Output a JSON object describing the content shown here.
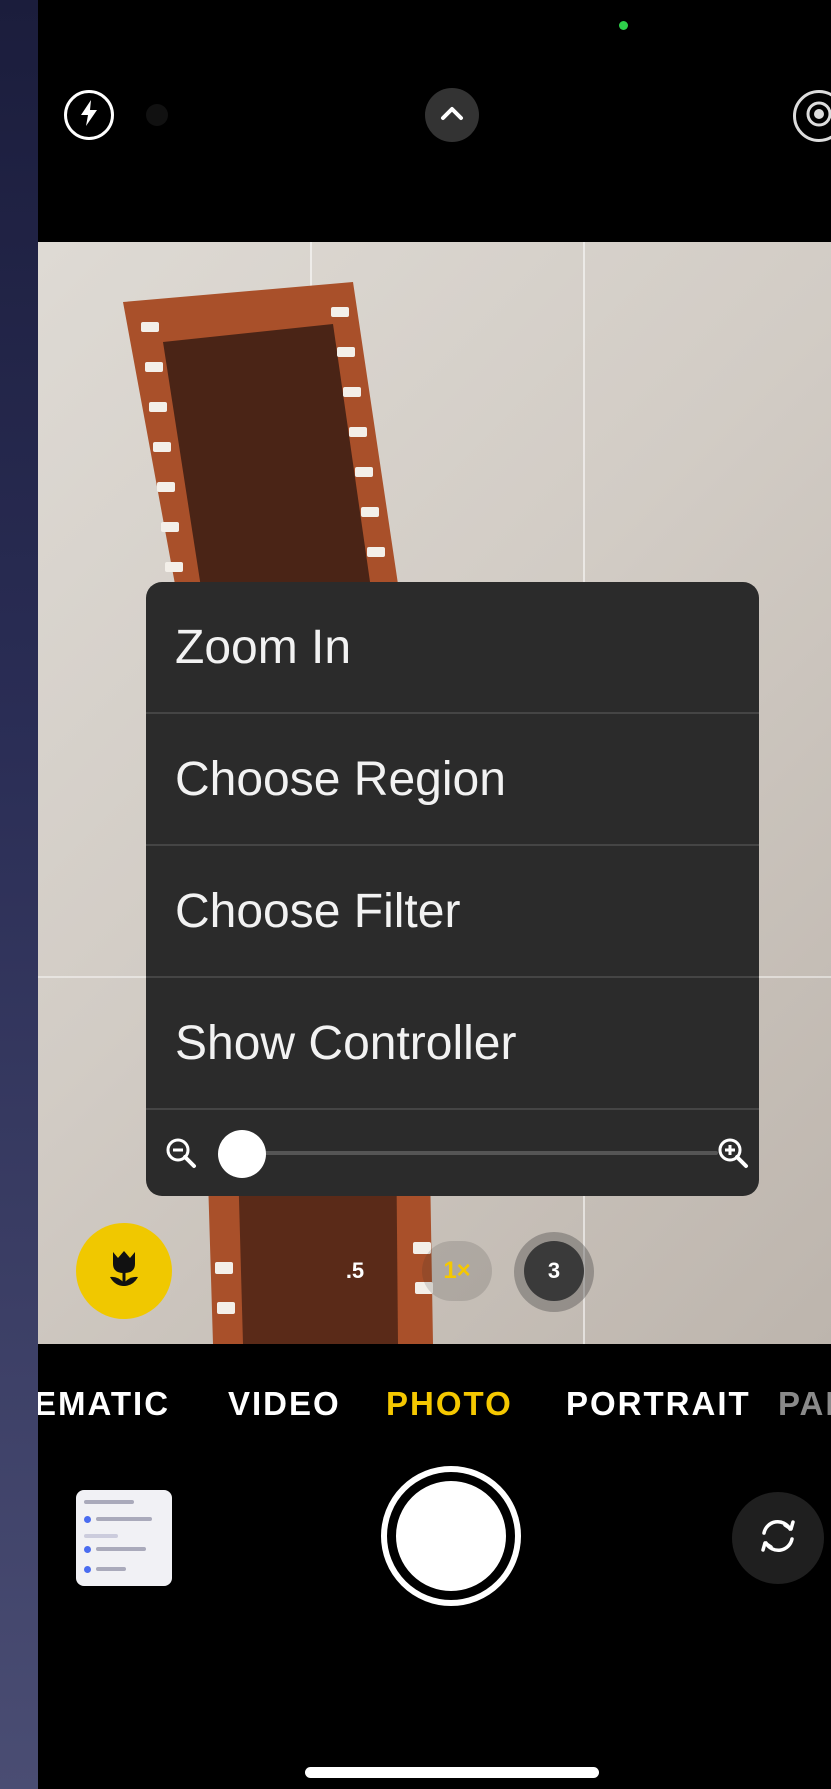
{
  "context_menu": {
    "items": [
      {
        "label": "Zoom In"
      },
      {
        "label": "Choose Region"
      },
      {
        "label": "Choose Filter"
      },
      {
        "label": "Show Controller"
      }
    ],
    "zoom_slider_level": 0.0
  },
  "zoom_controls": {
    "half": ".5",
    "one": "1×",
    "three": "3"
  },
  "modes": {
    "cinematic": "EMATIC",
    "video": "VIDEO",
    "photo": "PHOTO",
    "portrait": "PORTRAIT",
    "pano": "PAN"
  },
  "colors": {
    "accent": "#f5c800",
    "menu_background": "#2b2b2b",
    "indicator_green": "#2ecf4a"
  },
  "icons": {
    "flash": "flash-icon",
    "chevron": "chevron-up-icon",
    "live": "live-photo-icon",
    "macro": "flower-icon",
    "zoom_out": "zoom-out-icon",
    "zoom_in": "zoom-in-icon",
    "flip": "camera-flip-icon"
  }
}
